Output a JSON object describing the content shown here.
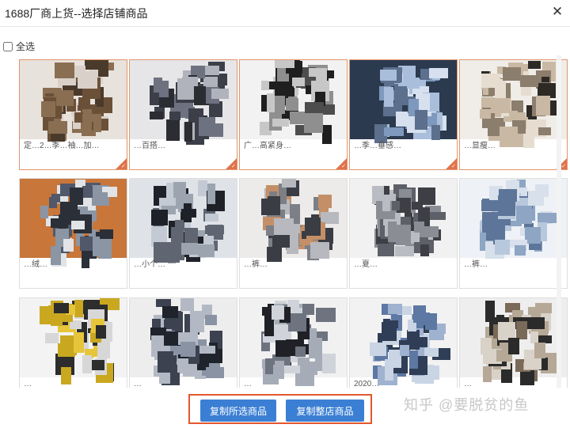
{
  "dialog": {
    "title": "1688厂商上货--选择店铺商品",
    "close_glyph": "✕"
  },
  "select_all": {
    "label": "全选",
    "checked": false
  },
  "products": [
    {
      "caption": "定…2…季…袖…加…",
      "selected": true,
      "palette": [
        "#e8e2dc",
        "#6b5038",
        "#8a6e52",
        "#d9d1c9",
        "#4a3a2c"
      ]
    },
    {
      "caption": "…百搭…",
      "selected": true,
      "palette": [
        "#e6e6e8",
        "#3c3f48",
        "#6e7180",
        "#2b2d33",
        "#b0b3bc"
      ]
    },
    {
      "caption": "广…高紧身…",
      "selected": true,
      "palette": [
        "#f2f2f2",
        "#1f1f1f",
        "#8f8f8f",
        "#c7c7c7",
        "#4d4d4d"
      ]
    },
    {
      "caption": "…季…垂感…",
      "selected": true,
      "palette": [
        "#2c3a4f",
        "#7f98bd",
        "#a9bedb",
        "#5c6f8c",
        "#d6e0ee"
      ]
    },
    {
      "caption": "…显瘦…",
      "selected": true,
      "palette": [
        "#f0ede8",
        "#2d2a26",
        "#c9b9a4",
        "#e6ddd0",
        "#8c7e6c"
      ]
    },
    {
      "caption": "…绒…",
      "selected": false,
      "palette": [
        "#c8763a",
        "#2a2f38",
        "#8b95a4",
        "#e1e3e6",
        "#50586a"
      ]
    },
    {
      "caption": "…小个…",
      "selected": false,
      "palette": [
        "#dfe3e8",
        "#1e2128",
        "#9ca4b0",
        "#c4cad3",
        "#5f6672"
      ]
    },
    {
      "caption": "…裤…",
      "selected": false,
      "palette": [
        "#ecebea",
        "#c48f67",
        "#3a3d44",
        "#b7b9bf",
        "#7c7f86"
      ]
    },
    {
      "caption": "…夏…",
      "selected": false,
      "palette": [
        "#f1f1f1",
        "#3d3f45",
        "#8a8d94",
        "#b9bcc2",
        "#5d6068"
      ]
    },
    {
      "caption": "…裤…",
      "selected": false,
      "palette": [
        "#eef1f5",
        "#8ea5c4",
        "#b8c8dc",
        "#5d7598",
        "#d7e0eb"
      ]
    },
    {
      "caption": "…",
      "selected": false,
      "palette": [
        "#f3f3f3",
        "#e7c53a",
        "#c9a820",
        "#2d2d2d",
        "#d7d7d7"
      ]
    },
    {
      "caption": "…",
      "selected": false,
      "palette": [
        "#ededed",
        "#3c4250",
        "#8a93a3",
        "#1f232b",
        "#b3b9c4"
      ]
    },
    {
      "caption": "…",
      "selected": false,
      "palette": [
        "#f1f1f1",
        "#1f2126",
        "#6e7380",
        "#a6acb7",
        "#d0d4da"
      ]
    },
    {
      "caption": "2020…",
      "selected": false,
      "palette": [
        "#f2f2f2",
        "#5d78a3",
        "#9fb2cf",
        "#2f3d56",
        "#c9d4e4"
      ]
    },
    {
      "caption": "…",
      "selected": false,
      "palette": [
        "#eeeeee",
        "#2b2b2b",
        "#7a6a58",
        "#b5a896",
        "#d9d2c8"
      ]
    }
  ],
  "footer": {
    "copy_selected": "复制所选商品",
    "copy_store": "复制整店商品"
  },
  "watermark": "知乎 @要脱贫的鱼",
  "colors": {
    "accent": "#3b7fd4",
    "highlight_border": "#e2572e",
    "selected_card": "#e2956c"
  }
}
